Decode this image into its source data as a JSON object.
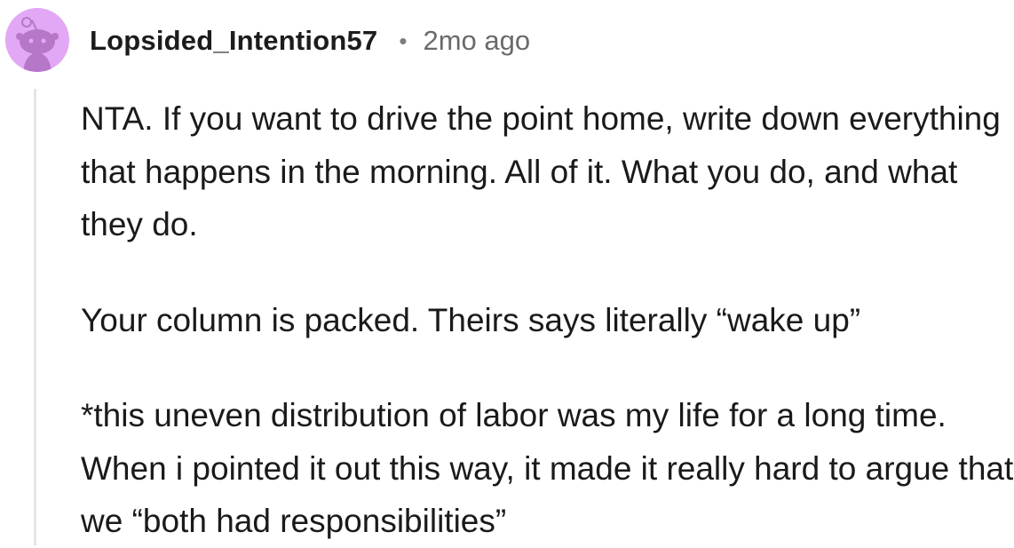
{
  "comment": {
    "author": "Lopsided_Intention57",
    "separator": "•",
    "timestamp": "2mo ago",
    "avatar_icon": "reddit-snoo-avatar-icon",
    "avatar_color": "#e3a8f5",
    "paragraphs": [
      "NTA. If you want to drive the point home, write down everything that happens in the morning. All of it. What you do, and what they do.",
      "Your column is packed. Theirs says literally “wake up”",
      "*this uneven distribution of labor was my life for a long time. When i pointed it out this way, it made it really hard to argue that we “both had responsibilities”"
    ]
  }
}
